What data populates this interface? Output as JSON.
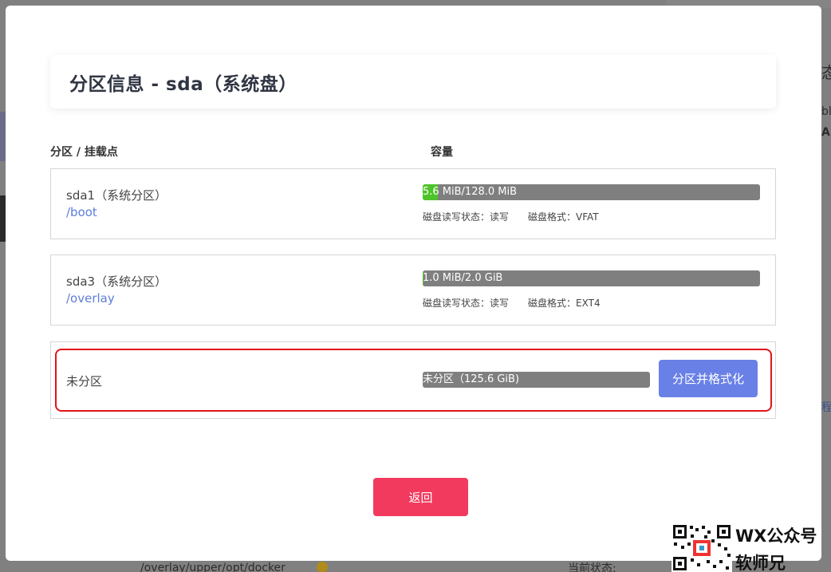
{
  "background": {
    "snippets": [
      "态",
      "bl",
      "AN",
      "程",
      "/overlay/upper/opt/docker",
      "当前状态:"
    ]
  },
  "modal": {
    "title": "分区信息 - sda（系统盘）",
    "column_headers": {
      "partition": "分区 / 挂载点",
      "capacity": "容量"
    },
    "partitions": [
      {
        "name": "sda1（系统分区）",
        "mount": "/boot",
        "usage_text": "5.6 MiB/128.0 MiB",
        "usage_fraction": 0.044,
        "rw_label": "磁盘读写状态：读写",
        "fs_label": "磁盘格式：VFAT"
      },
      {
        "name": "sda3（系统分区）",
        "mount": "/overlay",
        "usage_text": "1.0 MiB/2.0 GiB",
        "usage_fraction": 0.0005,
        "rw_label": "磁盘读写状态：读写",
        "fs_label": "磁盘格式：EXT4"
      },
      {
        "name": "未分区",
        "usage_text": "未分区（125.6 GiB)",
        "usage_fraction": 0,
        "action_label": "分区并格式化"
      }
    ],
    "back_label": "返回"
  },
  "watermark": {
    "line1": "WX公众号",
    "line2": "软师兄"
  },
  "colors": {
    "accent_button": "#6981e6",
    "back_button": "#f23a5e",
    "usage_fill": "#4fc32b",
    "bar_track": "#7f7f7f",
    "mount_link": "#5e7ddb",
    "highlight": "#e0141e"
  }
}
